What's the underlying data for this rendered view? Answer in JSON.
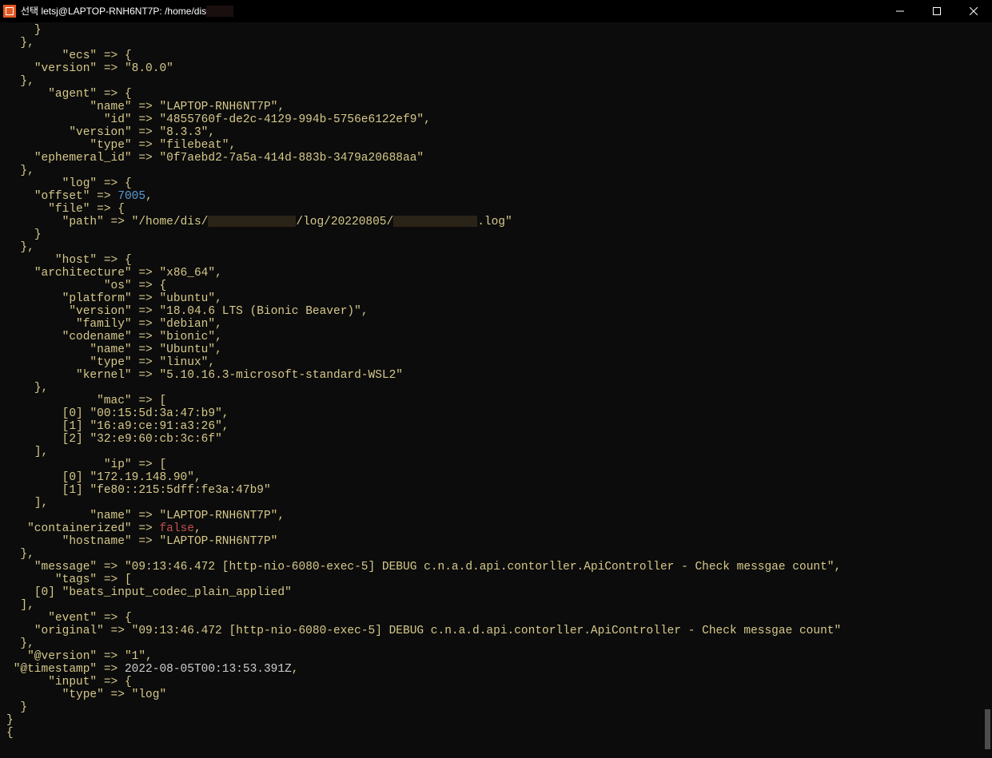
{
  "titlebar": {
    "prefix": "선택",
    "title": "letsj@LAPTOP-RNH6NT7P: /home/dis"
  },
  "lines": [
    {
      "i": 4,
      "t": "brace",
      "v": "}"
    },
    {
      "i": 2,
      "t": "brace",
      "v": "},"
    },
    {
      "i": 8,
      "t": "open",
      "k": "ecs",
      "after": "{"
    },
    {
      "i": 4,
      "t": "kv",
      "k": "version",
      "v": "8.0.0",
      "vt": "s",
      "comma": false
    },
    {
      "i": 2,
      "t": "brace",
      "v": "},"
    },
    {
      "i": 6,
      "t": "open",
      "k": "agent",
      "after": "{"
    },
    {
      "i": 12,
      "t": "kv",
      "k": "name",
      "v": "LAPTOP-RNH6NT7P",
      "vt": "s",
      "comma": true
    },
    {
      "i": 14,
      "t": "kv",
      "k": "id",
      "v": "4855760f-de2c-4129-994b-5756e6122ef9",
      "vt": "s",
      "comma": true
    },
    {
      "i": 9,
      "t": "kv",
      "k": "version",
      "v": "8.3.3",
      "vt": "s",
      "comma": true
    },
    {
      "i": 12,
      "t": "kv",
      "k": "type",
      "v": "filebeat",
      "vt": "s",
      "comma": true
    },
    {
      "i": 4,
      "t": "kv",
      "k": "ephemeral_id",
      "v": "0f7aebd2-7a5a-414d-883b-3479a20688aa",
      "vt": "s",
      "comma": false
    },
    {
      "i": 2,
      "t": "brace",
      "v": "},"
    },
    {
      "i": 8,
      "t": "open",
      "k": "log",
      "after": "{"
    },
    {
      "i": 4,
      "t": "kv",
      "k": "offset",
      "v": "7005",
      "vt": "num",
      "comma": true
    },
    {
      "i": 6,
      "t": "open",
      "k": "file",
      "after": "{"
    },
    {
      "i": 8,
      "t": "kvred",
      "k": "path",
      "pre": "/home/dis/",
      "mid": "/log/20220805/",
      "suf": ".log",
      "r1": 110,
      "r2": 105
    },
    {
      "i": 4,
      "t": "brace",
      "v": "}"
    },
    {
      "i": 2,
      "t": "brace",
      "v": "},"
    },
    {
      "i": 7,
      "t": "open",
      "k": "host",
      "after": "{"
    },
    {
      "i": 4,
      "t": "kv",
      "k": "architecture",
      "v": "x86_64",
      "vt": "s",
      "comma": true
    },
    {
      "i": 14,
      "t": "open",
      "k": "os",
      "after": "{"
    },
    {
      "i": 8,
      "t": "kv",
      "k": "platform",
      "v": "ubuntu",
      "vt": "s",
      "comma": true
    },
    {
      "i": 9,
      "t": "kv",
      "k": "version",
      "v": "18.04.6 LTS (Bionic Beaver)",
      "vt": "s",
      "comma": true
    },
    {
      "i": 10,
      "t": "kv",
      "k": "family",
      "v": "debian",
      "vt": "s",
      "comma": true
    },
    {
      "i": 8,
      "t": "kv",
      "k": "codename",
      "v": "bionic",
      "vt": "s",
      "comma": true
    },
    {
      "i": 12,
      "t": "kv",
      "k": "name",
      "v": "Ubuntu",
      "vt": "s",
      "comma": true
    },
    {
      "i": 12,
      "t": "kv",
      "k": "type",
      "v": "linux",
      "vt": "s",
      "comma": true
    },
    {
      "i": 10,
      "t": "kv",
      "k": "kernel",
      "v": "5.10.16.3-microsoft-standard-WSL2",
      "vt": "s",
      "comma": false
    },
    {
      "i": 4,
      "t": "brace",
      "v": "},"
    },
    {
      "i": 13,
      "t": "open",
      "k": "mac",
      "after": "["
    },
    {
      "i": 8,
      "t": "arr",
      "idx": 0,
      "v": "00:15:5d:3a:47:b9",
      "comma": true
    },
    {
      "i": 8,
      "t": "arr",
      "idx": 1,
      "v": "16:a9:ce:91:a3:26",
      "comma": true
    },
    {
      "i": 8,
      "t": "arr",
      "idx": 2,
      "v": "32:e9:60:cb:3c:6f",
      "comma": false
    },
    {
      "i": 4,
      "t": "brace",
      "v": "],"
    },
    {
      "i": 14,
      "t": "open",
      "k": "ip",
      "after": "["
    },
    {
      "i": 8,
      "t": "arr",
      "idx": 0,
      "v": "172.19.148.90",
      "comma": true
    },
    {
      "i": 8,
      "t": "arr",
      "idx": 1,
      "v": "fe80::215:5dff:fe3a:47b9",
      "comma": false
    },
    {
      "i": 4,
      "t": "brace",
      "v": "],"
    },
    {
      "i": 12,
      "t": "kv",
      "k": "name",
      "v": "LAPTOP-RNH6NT7P",
      "vt": "s",
      "comma": true
    },
    {
      "i": 3,
      "t": "kv",
      "k": "containerized",
      "v": "false",
      "vt": "bool",
      "comma": true
    },
    {
      "i": 8,
      "t": "kv",
      "k": "hostname",
      "v": "LAPTOP-RNH6NT7P",
      "vt": "s",
      "comma": false
    },
    {
      "i": 2,
      "t": "brace",
      "v": "},"
    },
    {
      "i": 4,
      "t": "kv",
      "k": "message",
      "v": "09:13:46.472 [http-nio-6080-exec-5] DEBUG c.n.a.d.api.contorller.ApiController - Check messgae count",
      "vt": "s",
      "comma": true
    },
    {
      "i": 7,
      "t": "open",
      "k": "tags",
      "after": "["
    },
    {
      "i": 4,
      "t": "arr",
      "idx": 0,
      "v": "beats_input_codec_plain_applied",
      "comma": false
    },
    {
      "i": 2,
      "t": "brace",
      "v": "],"
    },
    {
      "i": 6,
      "t": "open",
      "k": "event",
      "after": "{"
    },
    {
      "i": 4,
      "t": "kv",
      "k": "original",
      "v": "09:13:46.472 [http-nio-6080-exec-5] DEBUG c.n.a.d.api.contorller.ApiController - Check messgae count",
      "vt": "s",
      "comma": false
    },
    {
      "i": 2,
      "t": "brace",
      "v": "},"
    },
    {
      "i": 3,
      "t": "kv",
      "k": "@version",
      "v": "1",
      "vt": "s",
      "comma": true
    },
    {
      "i": 1,
      "t": "kv",
      "k": "@timestamp",
      "v": "2022-08-05T00:13:53.391Z",
      "vt": "plain",
      "comma": true
    },
    {
      "i": 6,
      "t": "open",
      "k": "input",
      "after": "{"
    },
    {
      "i": 8,
      "t": "kv",
      "k": "type",
      "v": "log",
      "vt": "s",
      "comma": false
    },
    {
      "i": 2,
      "t": "brace",
      "v": "}"
    },
    {
      "i": 0,
      "t": "brace",
      "v": "}"
    },
    {
      "i": 0,
      "t": "brace",
      "v": "{"
    }
  ]
}
